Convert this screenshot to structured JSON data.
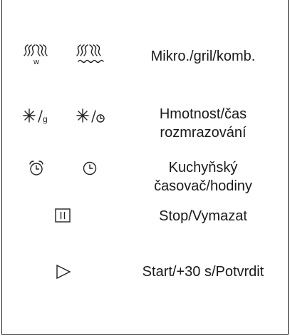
{
  "rows": [
    {
      "label_lines": [
        "Mikro./gril/komb."
      ],
      "icons": [
        "microwave-w-icon",
        "microwave-grill-icon"
      ]
    },
    {
      "label_lines": [
        "Hmotnost/čas",
        "rozmrazování"
      ],
      "icons": [
        "defrost-weight-icon",
        "defrost-time-icon"
      ]
    },
    {
      "label_lines": [
        "Kuchyňský",
        "časovač/hodiny"
      ],
      "icons": [
        "alarm-clock-icon",
        "clock-icon"
      ]
    },
    {
      "label_lines": [
        "Stop/Vymazat"
      ],
      "icons": [
        "pause-stop-icon"
      ]
    },
    {
      "label_lines": [
        "Start/+30 s/Potvrdit"
      ],
      "icons": [
        "play-start-icon"
      ]
    }
  ],
  "icon_glyph_text": {
    "weight_unit": "g"
  }
}
